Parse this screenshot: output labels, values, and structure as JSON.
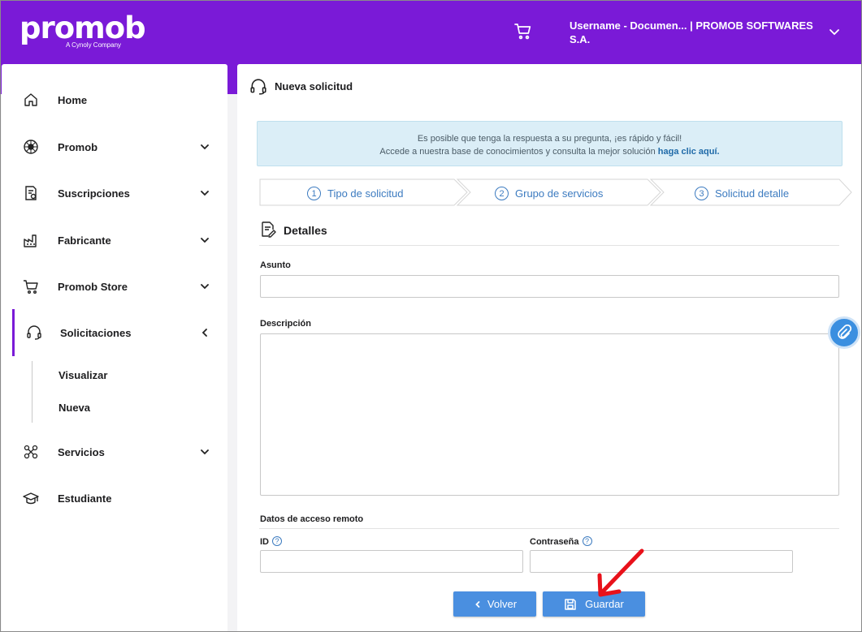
{
  "header": {
    "logo_text": "promob",
    "logo_sub": "A Cynoly Company",
    "user_label": "Username - Documen... | PROMOB SOFTWARES S.A."
  },
  "sidebar": {
    "items": [
      {
        "label": "Home",
        "icon": "home-icon"
      },
      {
        "label": "Promob",
        "icon": "promob-icon"
      },
      {
        "label": "Suscripciones",
        "icon": "subscription-icon"
      },
      {
        "label": "Fabricante",
        "icon": "factory-icon"
      },
      {
        "label": "Promob Store",
        "icon": "cart-icon"
      },
      {
        "label": "Solicitaciones",
        "icon": "headset-icon"
      },
      {
        "label": "Servicios",
        "icon": "services-icon"
      },
      {
        "label": "Estudiante",
        "icon": "graduation-cap-icon"
      }
    ],
    "subitems": [
      {
        "label": "Visualizar"
      },
      {
        "label": "Nueva"
      }
    ]
  },
  "main": {
    "title": "Nueva solicitud",
    "info_line1": "Es posible que tenga la respuesta a su pregunta, ¡es rápido y fácil!",
    "info_line2": "Accede a nuestra base de conocimientos y consulta la mejor solución ",
    "info_link": "haga clic aquí.",
    "steps": [
      {
        "num": "1",
        "label": "Tipo de solicitud"
      },
      {
        "num": "2",
        "label": "Grupo de servicios"
      },
      {
        "num": "3",
        "label": "Solicitud detalle"
      }
    ],
    "section_title": "Detalles",
    "subject_label": "Asunto",
    "subject_value": "",
    "description_label": "Descripción",
    "description_value": "",
    "remote_title": "Datos de acceso remoto",
    "id_label": "ID",
    "id_value": "",
    "password_label": "Contraseña",
    "password_value": "",
    "help_glyph": "?",
    "back_label": "Volver",
    "save_label": "Guardar"
  },
  "colors": {
    "brand": "#7a1ad7",
    "accent": "#4a8fe0",
    "info_bg": "#dbeef7",
    "annotation_arrow": "#e8111a"
  }
}
